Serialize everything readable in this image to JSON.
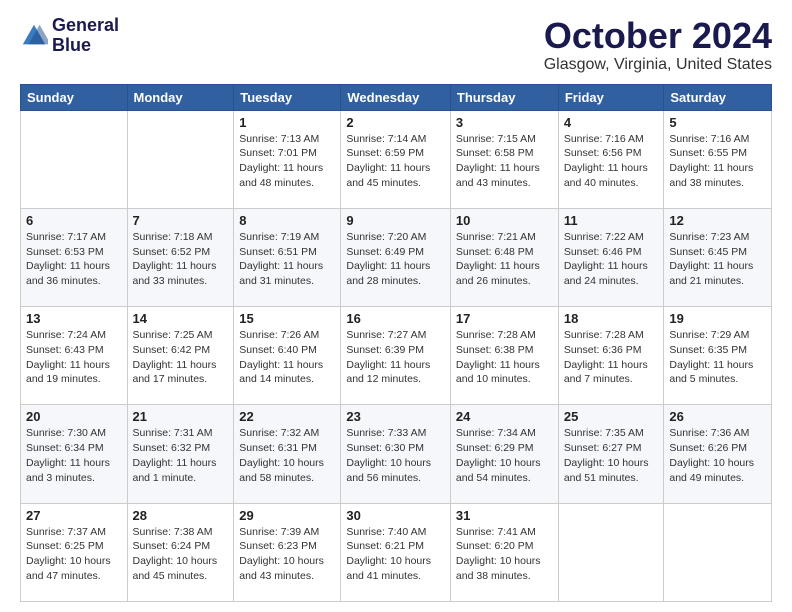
{
  "logo": {
    "line1": "General",
    "line2": "Blue"
  },
  "title": "October 2024",
  "subtitle": "Glasgow, Virginia, United States",
  "days_header": [
    "Sunday",
    "Monday",
    "Tuesday",
    "Wednesday",
    "Thursday",
    "Friday",
    "Saturday"
  ],
  "weeks": [
    [
      {
        "day": "",
        "detail": ""
      },
      {
        "day": "",
        "detail": ""
      },
      {
        "day": "1",
        "detail": "Sunrise: 7:13 AM\nSunset: 7:01 PM\nDaylight: 11 hours\nand 48 minutes."
      },
      {
        "day": "2",
        "detail": "Sunrise: 7:14 AM\nSunset: 6:59 PM\nDaylight: 11 hours\nand 45 minutes."
      },
      {
        "day": "3",
        "detail": "Sunrise: 7:15 AM\nSunset: 6:58 PM\nDaylight: 11 hours\nand 43 minutes."
      },
      {
        "day": "4",
        "detail": "Sunrise: 7:16 AM\nSunset: 6:56 PM\nDaylight: 11 hours\nand 40 minutes."
      },
      {
        "day": "5",
        "detail": "Sunrise: 7:16 AM\nSunset: 6:55 PM\nDaylight: 11 hours\nand 38 minutes."
      }
    ],
    [
      {
        "day": "6",
        "detail": "Sunrise: 7:17 AM\nSunset: 6:53 PM\nDaylight: 11 hours\nand 36 minutes."
      },
      {
        "day": "7",
        "detail": "Sunrise: 7:18 AM\nSunset: 6:52 PM\nDaylight: 11 hours\nand 33 minutes."
      },
      {
        "day": "8",
        "detail": "Sunrise: 7:19 AM\nSunset: 6:51 PM\nDaylight: 11 hours\nand 31 minutes."
      },
      {
        "day": "9",
        "detail": "Sunrise: 7:20 AM\nSunset: 6:49 PM\nDaylight: 11 hours\nand 28 minutes."
      },
      {
        "day": "10",
        "detail": "Sunrise: 7:21 AM\nSunset: 6:48 PM\nDaylight: 11 hours\nand 26 minutes."
      },
      {
        "day": "11",
        "detail": "Sunrise: 7:22 AM\nSunset: 6:46 PM\nDaylight: 11 hours\nand 24 minutes."
      },
      {
        "day": "12",
        "detail": "Sunrise: 7:23 AM\nSunset: 6:45 PM\nDaylight: 11 hours\nand 21 minutes."
      }
    ],
    [
      {
        "day": "13",
        "detail": "Sunrise: 7:24 AM\nSunset: 6:43 PM\nDaylight: 11 hours\nand 19 minutes."
      },
      {
        "day": "14",
        "detail": "Sunrise: 7:25 AM\nSunset: 6:42 PM\nDaylight: 11 hours\nand 17 minutes."
      },
      {
        "day": "15",
        "detail": "Sunrise: 7:26 AM\nSunset: 6:40 PM\nDaylight: 11 hours\nand 14 minutes."
      },
      {
        "day": "16",
        "detail": "Sunrise: 7:27 AM\nSunset: 6:39 PM\nDaylight: 11 hours\nand 12 minutes."
      },
      {
        "day": "17",
        "detail": "Sunrise: 7:28 AM\nSunset: 6:38 PM\nDaylight: 11 hours\nand 10 minutes."
      },
      {
        "day": "18",
        "detail": "Sunrise: 7:28 AM\nSunset: 6:36 PM\nDaylight: 11 hours\nand 7 minutes."
      },
      {
        "day": "19",
        "detail": "Sunrise: 7:29 AM\nSunset: 6:35 PM\nDaylight: 11 hours\nand 5 minutes."
      }
    ],
    [
      {
        "day": "20",
        "detail": "Sunrise: 7:30 AM\nSunset: 6:34 PM\nDaylight: 11 hours\nand 3 minutes."
      },
      {
        "day": "21",
        "detail": "Sunrise: 7:31 AM\nSunset: 6:32 PM\nDaylight: 11 hours\nand 1 minute."
      },
      {
        "day": "22",
        "detail": "Sunrise: 7:32 AM\nSunset: 6:31 PM\nDaylight: 10 hours\nand 58 minutes."
      },
      {
        "day": "23",
        "detail": "Sunrise: 7:33 AM\nSunset: 6:30 PM\nDaylight: 10 hours\nand 56 minutes."
      },
      {
        "day": "24",
        "detail": "Sunrise: 7:34 AM\nSunset: 6:29 PM\nDaylight: 10 hours\nand 54 minutes."
      },
      {
        "day": "25",
        "detail": "Sunrise: 7:35 AM\nSunset: 6:27 PM\nDaylight: 10 hours\nand 51 minutes."
      },
      {
        "day": "26",
        "detail": "Sunrise: 7:36 AM\nSunset: 6:26 PM\nDaylight: 10 hours\nand 49 minutes."
      }
    ],
    [
      {
        "day": "27",
        "detail": "Sunrise: 7:37 AM\nSunset: 6:25 PM\nDaylight: 10 hours\nand 47 minutes."
      },
      {
        "day": "28",
        "detail": "Sunrise: 7:38 AM\nSunset: 6:24 PM\nDaylight: 10 hours\nand 45 minutes."
      },
      {
        "day": "29",
        "detail": "Sunrise: 7:39 AM\nSunset: 6:23 PM\nDaylight: 10 hours\nand 43 minutes."
      },
      {
        "day": "30",
        "detail": "Sunrise: 7:40 AM\nSunset: 6:21 PM\nDaylight: 10 hours\nand 41 minutes."
      },
      {
        "day": "31",
        "detail": "Sunrise: 7:41 AM\nSunset: 6:20 PM\nDaylight: 10 hours\nand 38 minutes."
      },
      {
        "day": "",
        "detail": ""
      },
      {
        "day": "",
        "detail": ""
      }
    ]
  ]
}
